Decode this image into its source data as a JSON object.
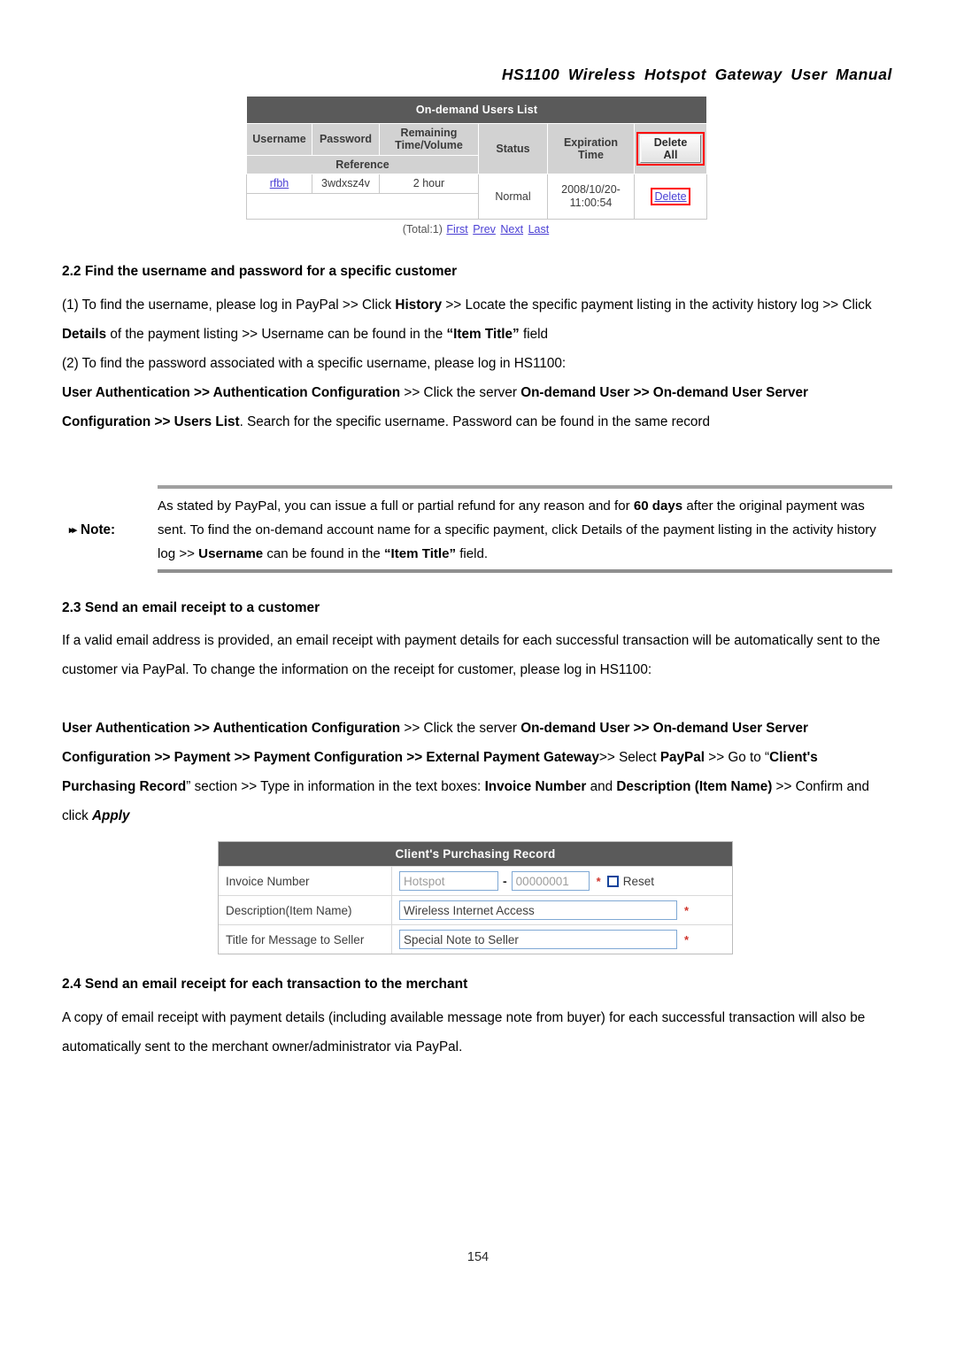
{
  "header": {
    "title": "HS1100 Wireless Hotspot Gateway User Manual"
  },
  "figure_users_list": {
    "title": "On-demand Users List",
    "columns": {
      "username": "Username",
      "password": "Password",
      "remaining": "Remaining Time/Volume",
      "reference": "Reference",
      "status": "Status",
      "expiration": "Expiration Time",
      "delete_all": "Delete All"
    },
    "rows": [
      {
        "username": "rfbh",
        "password": "3wdxsz4v",
        "remaining": "2 hour",
        "reference": "",
        "status": "Normal",
        "expiration_line1": "2008/10/20-",
        "expiration_line2": "11:00:54",
        "delete": "Delete"
      }
    ],
    "pager": {
      "total": "(Total:1)",
      "first": "First",
      "prev": "Prev",
      "next": "Next",
      "last": "Last"
    },
    "annotation_color": "#ff0000",
    "link_color": "#4a3fd4",
    "header_bg": "#5a5a5a",
    "column_header_bg": "#d2d2d2"
  },
  "section_22": {
    "heading": "2.2 Find the username and password for a specific customer",
    "p1": {
      "s1": "(1) To find the username, please log in PayPal >> Click ",
      "b1": "History",
      "s2": " >> Locate the specific payment listing in the activity history log >> Click ",
      "b2": "Details",
      "s3": " of the payment listing >> Username can be found in the ",
      "b3": "“Item Title”",
      "s4": " field"
    },
    "p2": "(2) To find the password associated with a specific username, please log in HS1100:",
    "p3": {
      "b1": "User Authentication >> Authentication Configuration",
      "s1": " >> Click the server ",
      "b2": "On-demand User >> On-demand User Server Configuration >> Users List",
      "s2": ". Search for the specific username. Password can be found in the same record"
    }
  },
  "note": {
    "label": "Note:",
    "arrow_icon": "double-right-triangle",
    "text": {
      "s1": "As stated by PayPal, you can issue a full or partial refund for any reason and for ",
      "b1": "60 days",
      "s2": " after the original payment was sent. To find the on-demand account name for a specific payment, click ",
      "bi1": "Details",
      "s3": " of the payment listing in the activity history log >> ",
      "b2": "Username",
      "s4": " can be found in the ",
      "b3": "“Item Title”",
      "s5": " field."
    }
  },
  "section_23": {
    "heading": "2.3 Send an email receipt to a customer",
    "p1": "If a valid email address is provided, an email receipt with payment details for each successful transaction will be automatically sent to the customer via PayPal. To change the information on the receipt for customer, please log in HS1100:",
    "p2": {
      "b1": "User Authentication >> Authentication Configuration",
      "s1": " >> Click the server ",
      "b2": "On-demand User >> On-demand User Server Configuration >> Payment >>  Payment  Configuration >>  External Payment Gateway",
      "s2": ">> Select ",
      "b3": "PayPal",
      "s3": " >> Go to “",
      "b4": "Client's Purchasing Record",
      "s4": "” section >> Type in information in the text boxes: ",
      "b5": "Invoice Number",
      "s5": " and ",
      "b6": "Description (Item Name)",
      "s6": " >> Confirm and click ",
      "bi1": "Apply"
    }
  },
  "figure_purchasing_record": {
    "title": "Client's Purchasing Record",
    "rows": [
      {
        "label": "Invoice Number",
        "prefix_value": "Hotspot",
        "separator": "-",
        "number_value": "00000001",
        "required_mark": "*",
        "reset_label": "Reset",
        "reset_checked": false
      },
      {
        "label": "Description(Item Name)",
        "value": "Wireless Internet Access",
        "required_mark": "*"
      },
      {
        "label": "Title for Message to Seller",
        "value": "Special Note to Seller",
        "required_mark": "*"
      }
    ],
    "header_bg": "#5a5a5a",
    "required_color": "#d0342c",
    "input_border": "#7fa8d4"
  },
  "section_24": {
    "heading": "2.4 Send an email receipt for each transaction to the merchant",
    "p1": "A copy of email receipt with payment details (including available message note from buyer) for each successful transaction will also be automatically sent to the merchant owner/administrator via PayPal."
  },
  "footer": {
    "page_number": "154"
  }
}
